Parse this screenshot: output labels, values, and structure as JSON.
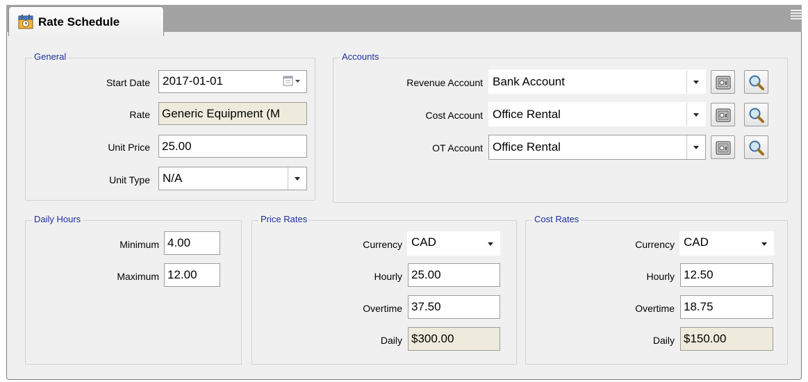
{
  "tab": {
    "title": "Rate Schedule",
    "icon": "calendar-icon"
  },
  "general": {
    "legend": "General",
    "start_date_label": "Start Date",
    "start_date": "2017-01-01",
    "rate_label": "Rate",
    "rate": "Generic Equipment (M",
    "unit_price_label": "Unit Price",
    "unit_price": "25.00",
    "unit_type_label": "Unit Type",
    "unit_type": "N/A"
  },
  "accounts": {
    "legend": "Accounts",
    "revenue_label": "Revenue Account",
    "revenue": "Bank Account",
    "cost_label": "Cost Account",
    "cost": "Office Rental",
    "ot_label": "OT Account",
    "ot": "Office Rental"
  },
  "daily_hours": {
    "legend": "Daily Hours",
    "minimum_label": "Minimum",
    "minimum": "4.00",
    "maximum_label": "Maximum",
    "maximum": "12.00"
  },
  "price_rates": {
    "legend": "Price Rates",
    "currency_label": "Currency",
    "currency": "CAD",
    "hourly_label": "Hourly",
    "hourly": "25.00",
    "overtime_label": "Overtime",
    "overtime": "37.50",
    "daily_label": "Daily",
    "daily": "$300.00"
  },
  "cost_rates": {
    "legend": "Cost Rates",
    "currency_label": "Currency",
    "currency": "CAD",
    "hourly_label": "Hourly",
    "hourly": "12.50",
    "overtime_label": "Overtime",
    "overtime": "18.75",
    "daily_label": "Daily",
    "daily": "$150.00"
  },
  "colors": {
    "legend_text": "#1e2f9f",
    "readonly_field": "#eeebdd",
    "tab_strip": "#a3a3a3",
    "panel": "#f0f0f0"
  }
}
